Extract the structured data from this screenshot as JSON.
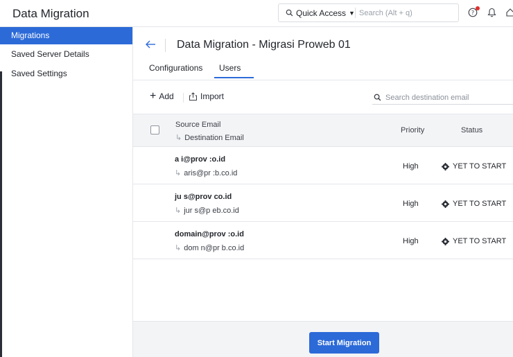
{
  "header": {
    "app_title": "Data Migration",
    "quick_access_label": "Quick Access",
    "search_placeholder": "Search (Alt + q)",
    "colors": {
      "notification_dot": "#e0302f"
    }
  },
  "sidebar": {
    "items": [
      {
        "label": "Migrations",
        "active": true
      },
      {
        "label": "Saved Server Details",
        "active": false
      },
      {
        "label": "Saved Settings",
        "active": false
      }
    ],
    "colors": {
      "active_bg": "#2c6ad8"
    }
  },
  "main": {
    "title": "Data Migration - Migrasi Proweb 01",
    "tabs": [
      {
        "label": "Configurations",
        "active": false
      },
      {
        "label": "Users",
        "active": true
      }
    ],
    "toolbar": {
      "add_label": "Add",
      "import_label": "Import",
      "search_placeholder": "Search destination email"
    },
    "table": {
      "headers": {
        "source": "Source Email",
        "destination": "Destination Email",
        "priority": "Priority",
        "status": "Status"
      },
      "rows": [
        {
          "source": "a   i@prov      :o.id",
          "destination": "aris@pr      :b.co.id",
          "priority": "High",
          "status": "YET TO START"
        },
        {
          "source": "ju   s@prov      co.id",
          "destination": "jur   s@p      eb.co.id",
          "priority": "High",
          "status": "YET TO START"
        },
        {
          "source": "domain@prov      :o.id",
          "destination": "dom    n@pr      b.co.id",
          "priority": "High",
          "status": "YET TO START"
        }
      ]
    },
    "footer": {
      "start_button_label": "Start Migration"
    }
  }
}
